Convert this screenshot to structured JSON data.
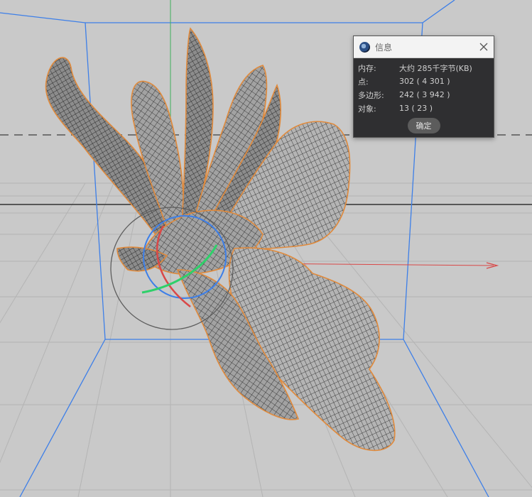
{
  "dialog": {
    "title": "信息",
    "rows": [
      {
        "label": "内存:",
        "value": "大约 285千字节(KB)"
      },
      {
        "label": "点:",
        "value": "302 ( 4 301 )"
      },
      {
        "label": "多边形:",
        "value": "242 ( 3 942 )"
      },
      {
        "label": "对象:",
        "value": "13 ( 23 )"
      }
    ],
    "ok_label": "确定"
  },
  "colors": {
    "viewport_bg": "#c9c9c9",
    "grid_line": "#b4b4b4",
    "bounding_box": "#3d7fe8",
    "axis_x": "#d94848",
    "axis_y": "#3faf5a",
    "mesh_fill": "#9a9a9a",
    "mesh_wire": "#1a1a1a",
    "selection_outline": "#e08a3c"
  },
  "icons": {
    "app": "cinema4d-icon",
    "close": "close-icon"
  }
}
